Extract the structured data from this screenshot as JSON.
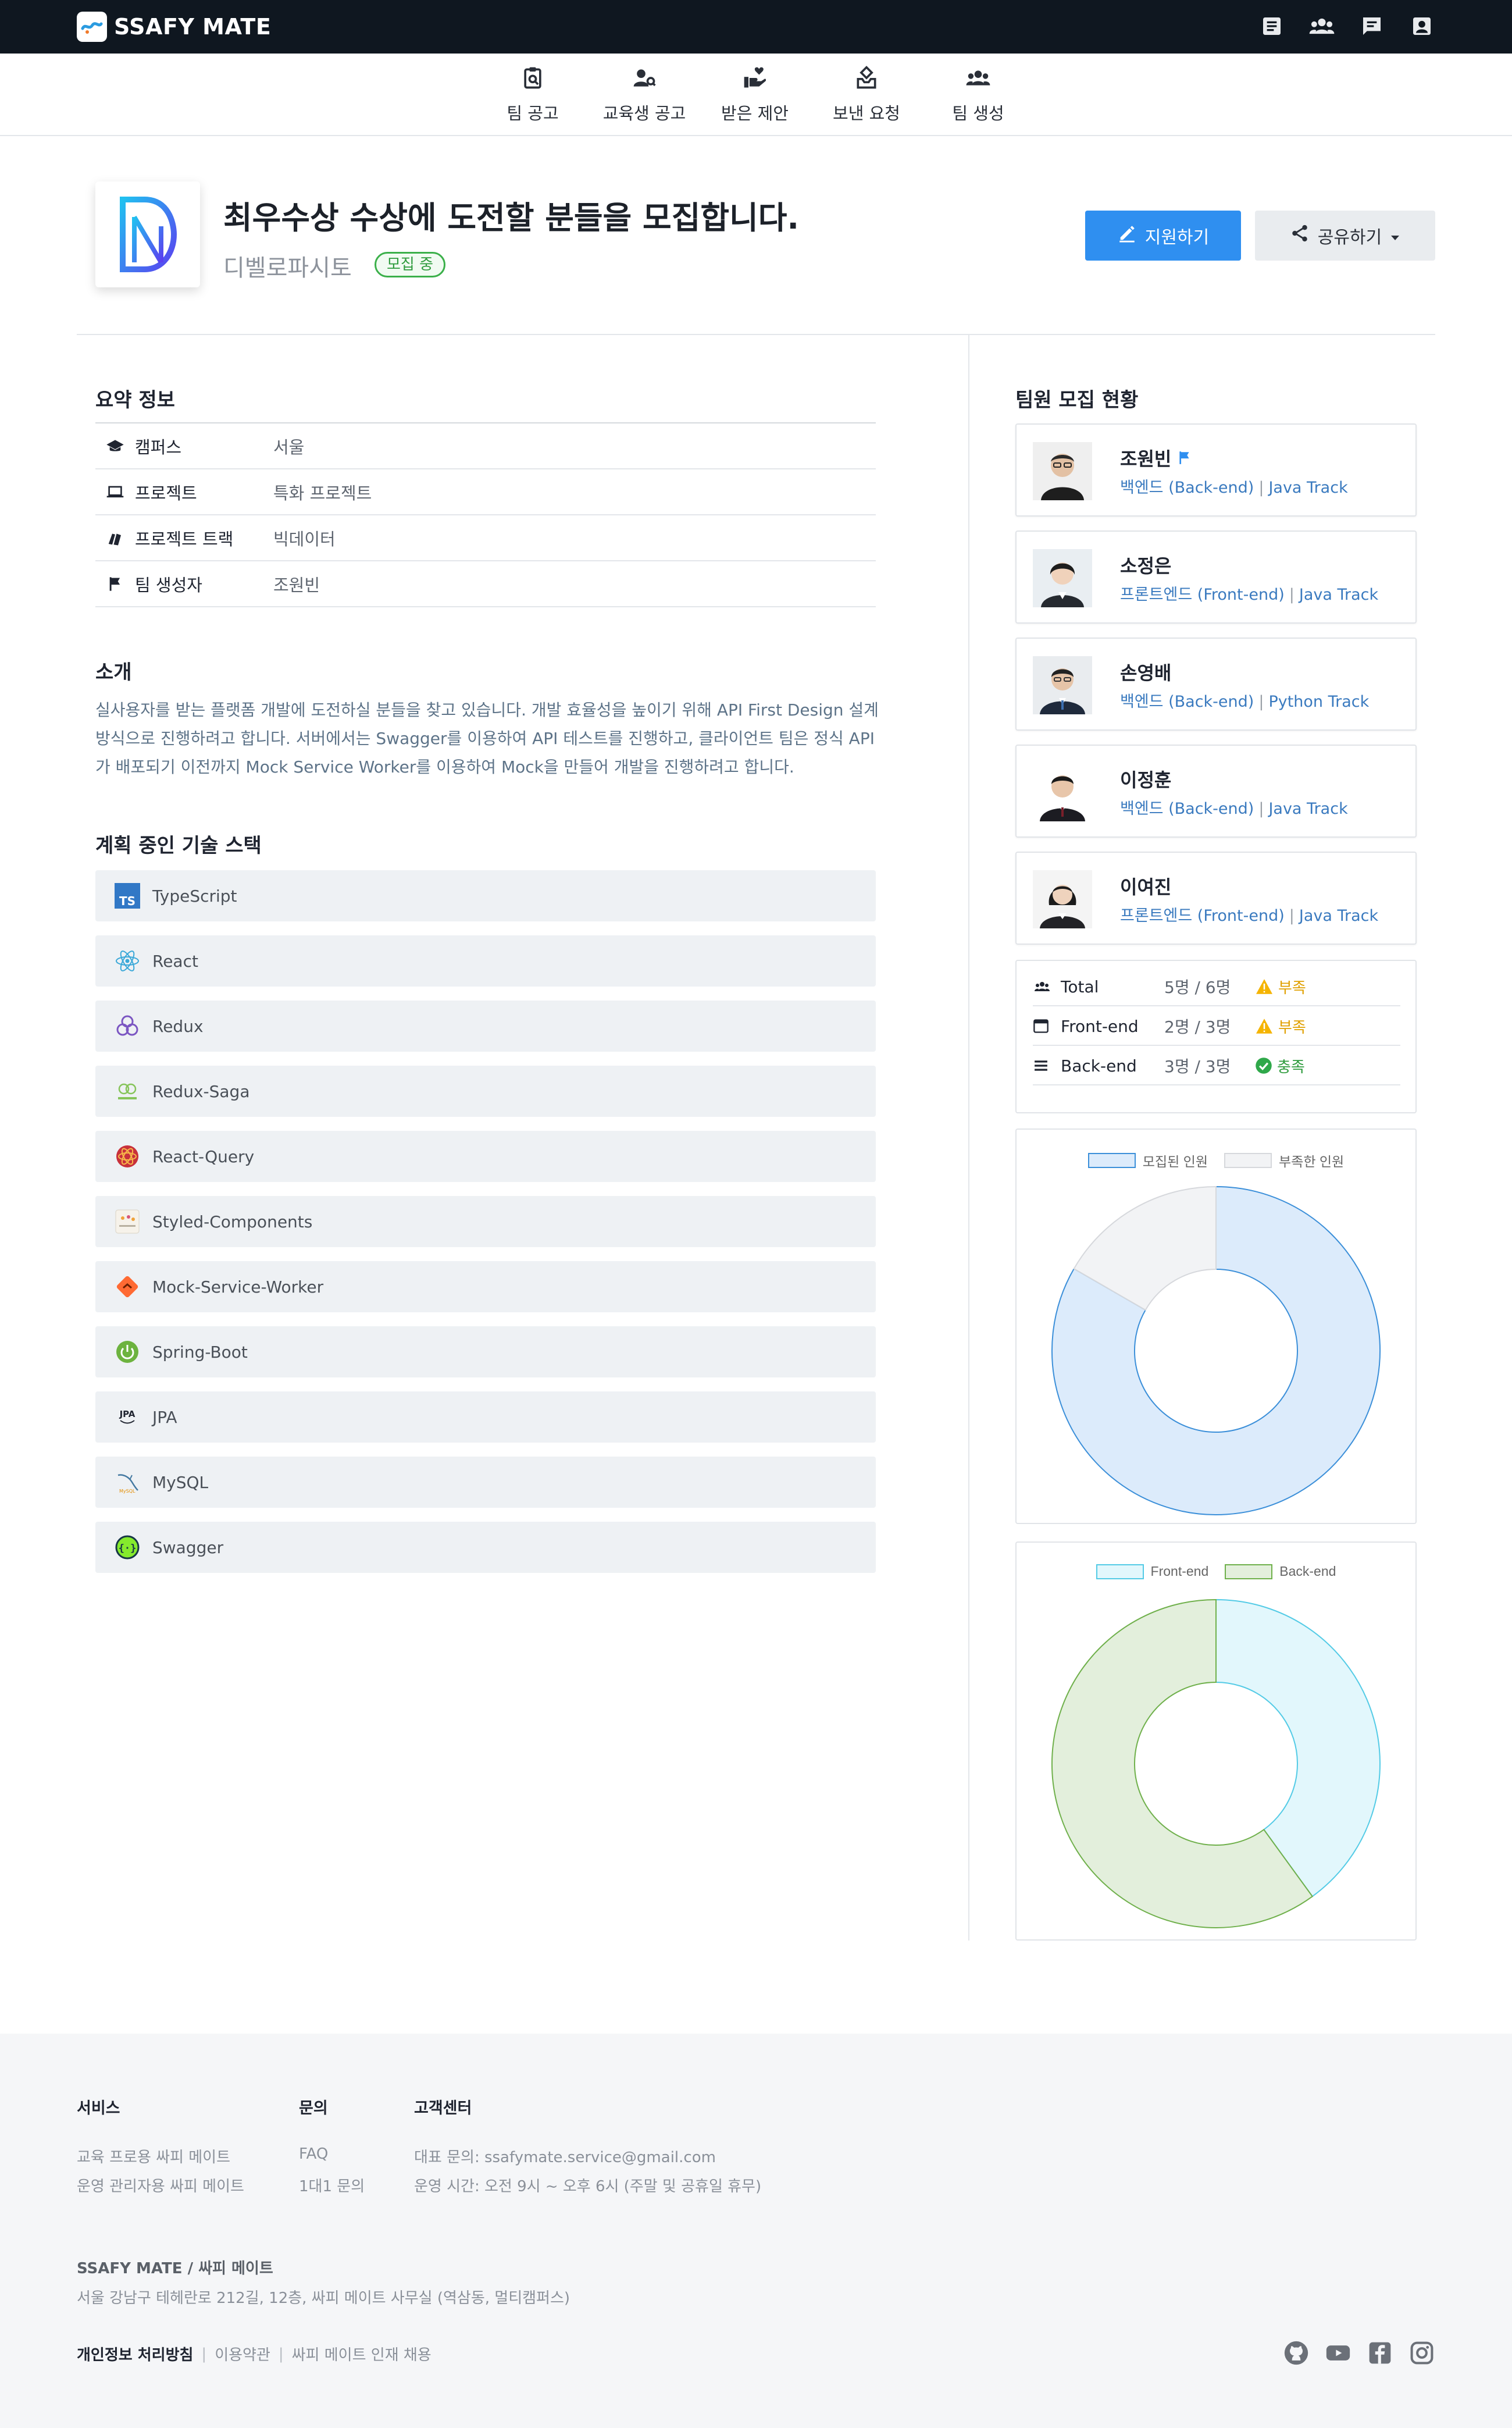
{
  "app": {
    "brand": "SSAFY MATE",
    "top_icons": [
      "board-icon",
      "group-icon",
      "chat-icon",
      "profile-icon"
    ]
  },
  "nav": {
    "items": [
      {
        "label": "팀 공고",
        "icon": "clipboard-search-icon"
      },
      {
        "label": "교육생 공고",
        "icon": "person-search-icon"
      },
      {
        "label": "받은 제안",
        "icon": "hand-heart-icon"
      },
      {
        "label": "보낸 요청",
        "icon": "send-request-icon"
      },
      {
        "label": "팀 생성",
        "icon": "group-add-icon"
      }
    ]
  },
  "header": {
    "title": "최우수상 수상에 도전할 분들을 모집합니다.",
    "team_name": "디벨로파시토",
    "status": "모집 중",
    "apply_label": "지원하기",
    "share_label": "공유하기"
  },
  "summary": {
    "title": "요약 정보",
    "rows": [
      {
        "icon": "graduation-cap-icon",
        "label": "캠퍼스",
        "value": "서울"
      },
      {
        "icon": "laptop-icon",
        "label": "프로젝트",
        "value": "특화 프로젝트"
      },
      {
        "icon": "books-icon",
        "label": "프로젝트 트랙",
        "value": "빅데이터"
      },
      {
        "icon": "flag-icon",
        "label": "팀 생성자",
        "value": "조원빈"
      }
    ]
  },
  "intro": {
    "title": "소개",
    "text": "실사용자를 받는 플랫폼 개발에 도전하실 분들을 찾고 있습니다. 개발 효율성을 높이기 위해 API First Design 설계 방식으로 진행하려고 합니다. 서버에서는 Swagger를 이용하여 API 테스트를 진행하고, 클라이언트 팀은 정식 API가 배포되기 이전까지 Mock Service Worker를 이용하여 Mock을 만들어 개발을 진행하려고 합니다."
  },
  "tech": {
    "title": "계획 중인 기술 스택",
    "items": [
      {
        "name": "TypeScript",
        "icon": "typescript-icon"
      },
      {
        "name": "React",
        "icon": "react-icon"
      },
      {
        "name": "Redux",
        "icon": "redux-icon"
      },
      {
        "name": "Redux-Saga",
        "icon": "redux-saga-icon"
      },
      {
        "name": "React-Query",
        "icon": "react-query-icon"
      },
      {
        "name": "Styled-Components",
        "icon": "styled-components-icon"
      },
      {
        "name": "Mock-Service-Worker",
        "icon": "msw-icon"
      },
      {
        "name": "Spring-Boot",
        "icon": "spring-boot-icon"
      },
      {
        "name": "JPA",
        "icon": "jpa-icon"
      },
      {
        "name": "MySQL",
        "icon": "mysql-icon"
      },
      {
        "name": "Swagger",
        "icon": "swagger-icon"
      }
    ]
  },
  "members": {
    "title": "팀원 모집 현황",
    "list": [
      {
        "name": "조원빈",
        "role": "백엔드 (Back-end)",
        "track": "Java Track",
        "leader": true
      },
      {
        "name": "소정은",
        "role": "프론트엔드 (Front-end)",
        "track": "Java Track",
        "leader": false
      },
      {
        "name": "손영배",
        "role": "백엔드 (Back-end)",
        "track": "Python Track",
        "leader": false
      },
      {
        "name": "이정훈",
        "role": "백엔드 (Back-end)",
        "track": "Java Track",
        "leader": false
      },
      {
        "name": "이여진",
        "role": "프론트엔드 (Front-end)",
        "track": "Java Track",
        "leader": false
      }
    ]
  },
  "stats": {
    "rows": [
      {
        "icon": "group-icon",
        "label": "Total",
        "count": "5명 / 6명",
        "status": "부족",
        "status_icon": "warning-icon",
        "status_color": "#e0a000"
      },
      {
        "icon": "browser-icon",
        "label": "Front-end",
        "count": "2명 / 3명",
        "status": "부족",
        "status_icon": "warning-icon",
        "status_color": "#e0a000"
      },
      {
        "icon": "list-icon",
        "label": "Back-end",
        "count": "3명 / 3명",
        "status": "충족",
        "status_icon": "check-circle-icon",
        "status_color": "#2e9b3d"
      }
    ]
  },
  "chart_data": [
    {
      "type": "pie",
      "donut": true,
      "labels": [
        "모집된 인원",
        "부족한 인원"
      ],
      "values": [
        5,
        1
      ],
      "colors": [
        "#dcebfb",
        "#f2f3f5"
      ],
      "border_colors": [
        "#3b8fd9",
        "#d6d8dc"
      ],
      "legend": "top"
    },
    {
      "type": "pie",
      "donut": true,
      "labels": [
        "Front-end",
        "Back-end"
      ],
      "values": [
        2,
        3
      ],
      "colors": [
        "#e2f7fc",
        "#e3efdc"
      ],
      "border_colors": [
        "#53cbe6",
        "#6fb04b"
      ],
      "legend": "top"
    }
  ],
  "footer": {
    "columns": [
      {
        "title": "서비스",
        "links": [
          "교육 프로용 싸피 메이트",
          "운영 관리자용 싸피 메이트"
        ]
      },
      {
        "title": "문의",
        "links": [
          "FAQ",
          "1대1 문의"
        ]
      },
      {
        "title": "고객센터",
        "links": [
          "대표 문의: ssafymate.service@gmail.com",
          "운영 시간: 오전 9시 ~ 오후 6시 (주말 및 공휴일 휴무)"
        ]
      }
    ],
    "company": "SSAFY MATE / 싸피 메이트",
    "address": "서울 강남구 테헤란로 212길, 12층, 싸피 메이트 사무실 (역삼동, 멀티캠퍼스)",
    "bottom_links": [
      "개인정보 처리방침",
      "이용약관",
      "싸피 메이트 인재 채용"
    ],
    "social": [
      "github-icon",
      "youtube-icon",
      "facebook-icon",
      "instagram-icon"
    ]
  }
}
